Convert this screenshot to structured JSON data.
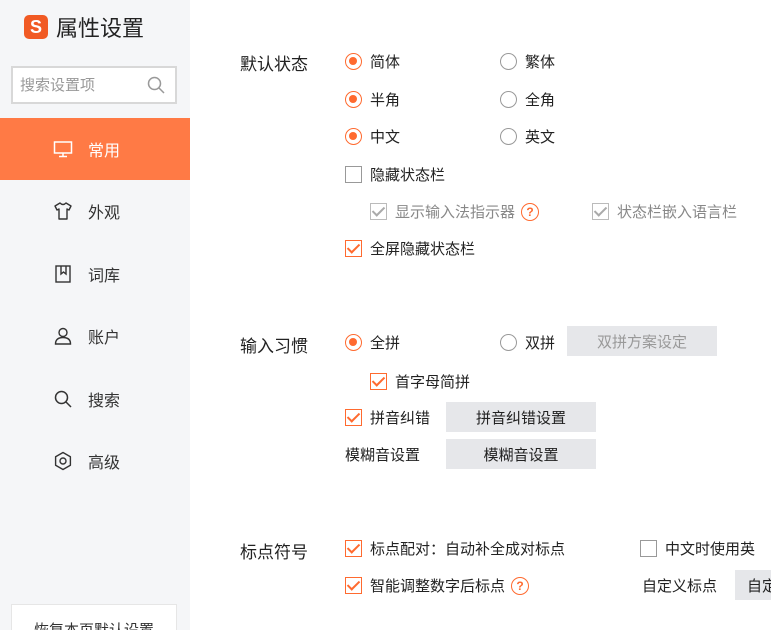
{
  "sidebar": {
    "logo_mark": "S",
    "title": "属性设置",
    "search_placeholder": "搜索设置项",
    "items": [
      {
        "label": "常用",
        "icon": "monitor-icon",
        "active": true
      },
      {
        "label": "外观",
        "icon": "shirt-icon",
        "active": false
      },
      {
        "label": "词库",
        "icon": "book-icon",
        "active": false
      },
      {
        "label": "账户",
        "icon": "user-icon",
        "active": false
      },
      {
        "label": "搜索",
        "icon": "search-icon",
        "active": false
      },
      {
        "label": "高级",
        "icon": "gear-icon",
        "active": false
      }
    ],
    "restore_label": "恢复本页默认设置"
  },
  "default_state": {
    "title": "默认状态",
    "simplified": "简体",
    "traditional": "繁体",
    "half_width": "半角",
    "full_width": "全角",
    "chinese": "中文",
    "english": "英文",
    "hide_status_bar": "隐藏状态栏",
    "show_indicator": "显示输入法指示器",
    "embed_language_bar": "状态栏嵌入语言栏",
    "fullscreen_hide": "全屏隐藏状态栏"
  },
  "input_habit": {
    "title": "输入习惯",
    "full_pinyin": "全拼",
    "double_pinyin": "双拼",
    "double_pinyin_settings": "双拼方案设定",
    "initial_abbrev": "首字母简拼",
    "pinyin_correction": "拼音纠错",
    "pinyin_correction_settings": "拼音纠错设置",
    "fuzzy_label": "模糊音设置",
    "fuzzy_settings": "模糊音设置"
  },
  "punctuation": {
    "title": "标点符号",
    "pairing": "标点配对：自动补全成对标点",
    "english_in_chinese": "中文时使用英",
    "smart_adjust": "智能调整数字后标点",
    "custom_label": "自定义标点",
    "custom_button": "自定"
  },
  "colors": {
    "accent": "#ff7a45",
    "check_orange": "#ff6a2f",
    "sidebar_bg": "#f5f6f8",
    "button_bg": "#e6e7ea"
  }
}
